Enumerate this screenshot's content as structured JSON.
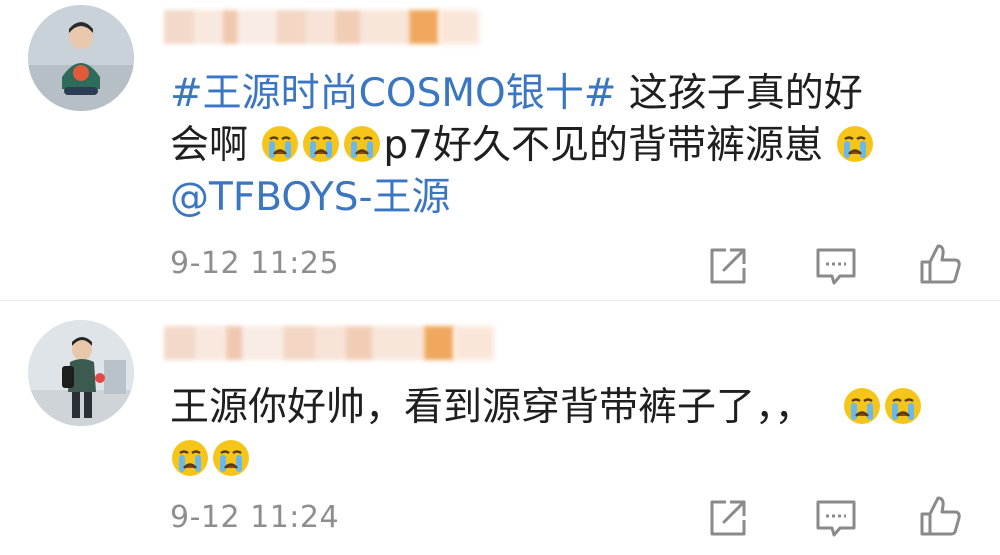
{
  "comments": [
    {
      "hashtag": "#王源时尚COSMO银十#",
      "line1_rest": " 这孩子真的好",
      "line2_a": "会啊",
      "line2_b": "p7好久不见的背带裤源崽",
      "mention": "@TFBOYS-王源",
      "time": "9-12 11:25",
      "icons": [
        "share-icon",
        "comment-icon",
        "like-icon"
      ]
    },
    {
      "line1": "王源你好帅，看到源穿背带裤子了，，",
      "time": "9-12 11:24",
      "icons": [
        "share-icon",
        "comment-icon",
        "like-icon"
      ]
    }
  ],
  "colors": {
    "link": "#3a76c2",
    "text": "#1f1f1f",
    "meta": "#8e8e8e",
    "emoji_face": "#f5c51a"
  }
}
